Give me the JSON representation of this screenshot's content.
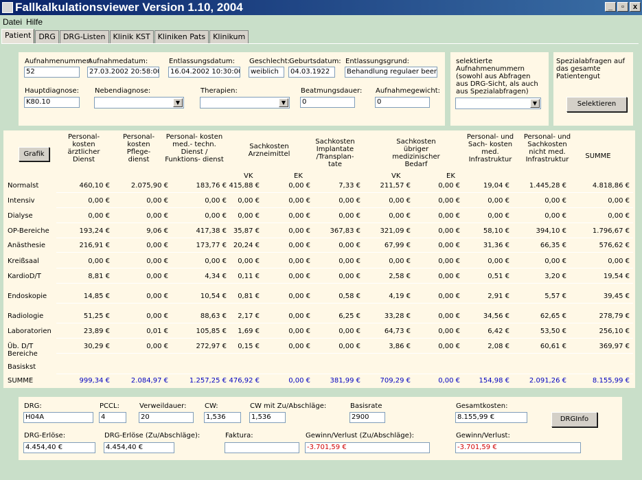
{
  "window": {
    "title": "Fallkalkulationsviewer Version 1.10, 2004",
    "minimize": "_",
    "maximize": "▫",
    "close": "x"
  },
  "menu": [
    "Datei",
    "Hilfe"
  ],
  "tabs": [
    "Patient",
    "DRG",
    "DRG-Listen",
    "Klinik KST",
    "Kliniken Pats",
    "Klinikum"
  ],
  "patient": {
    "aufnahmenummer_label": "Aufnahmenummer:",
    "aufnahmenummer": "52",
    "aufnahmedatum_label": "Aufnahmedatum:",
    "aufnahmedatum": "27.03.2002 20:58:00",
    "entlassungsdatum_label": "Entlassungsdatum:",
    "entlassungsdatum": "16.04.2002 10:30:00",
    "geschlecht_label": "Geschlecht:",
    "geschlecht": "weiblich",
    "geburtsdatum_label": "Geburtsdatum:",
    "geburtsdatum": "04.03.1922",
    "entlassungsgrund_label": "Entlassungsgrund:",
    "entlassungsgrund": "Behandlung regulaer beendet",
    "hauptdiagnose_label": "Hauptdiagnose:",
    "hauptdiagnose": "K80.10",
    "nebendiagnose_label": "Nebendiagnose:",
    "nebendiagnose": "",
    "therapien_label": "Therapien:",
    "therapien": "",
    "beatmungsdauer_label": "Beatmungsdauer:",
    "beatmungsdauer": "0",
    "aufnahmegewicht_label": "Aufnahmegewicht:",
    "aufnahmegewicht": "0"
  },
  "selection": {
    "text": "selektierte Aufnahmenummern (sowohl aus Abfragen aus DRG-Sicht, als auch aus Spezialabfragen)",
    "value": ""
  },
  "special": {
    "text": "Spezialabfragen auf das gesamte Patientengut",
    "button": "Selektieren"
  },
  "costs": {
    "grafik_button": "Grafik",
    "headers": [
      "Personal-\nkosten\närztlicher\nDienst",
      "Personal-\nkosten\nPflege-\ndienst",
      "Personal- kosten\nmed.- techn.\nDienst /\nFunktions- dienst",
      "Sachkosten\nArzneimittel",
      "Sachkosten\nImplantate\n/Transplan-\ntate",
      "Sachkosten\nübriger\nmedizinischer\nBedarf",
      "Personal- und\nSach- kosten\nmed.\nInfrastruktur",
      "Personal- und\nSachkosten\nnicht med.\nInfrastruktur",
      "SUMME"
    ],
    "sub_vk": "VK",
    "sub_ek": "EK",
    "rows": [
      {
        "label": "Normalst",
        "values": [
          "460,10 €",
          "2.075,90 €",
          "183,76 €",
          "415,88 €",
          "0,00 €",
          "7,33 €",
          "211,57 €",
          "0,00 €",
          "19,04 €",
          "1.445,28 €",
          "4.818,86 €"
        ]
      },
      {
        "label": "Intensiv",
        "values": [
          "0,00 €",
          "0,00 €",
          "0,00 €",
          "0,00 €",
          "0,00 €",
          "0,00 €",
          "0,00 €",
          "0,00 €",
          "0,00 €",
          "0,00 €",
          "0,00 €"
        ]
      },
      {
        "label": "Dialyse",
        "values": [
          "0,00 €",
          "0,00 €",
          "0,00 €",
          "0,00 €",
          "0,00 €",
          "0,00 €",
          "0,00 €",
          "0,00 €",
          "0,00 €",
          "0,00 €",
          "0,00 €"
        ]
      },
      {
        "label": "OP-Bereiche",
        "values": [
          "193,24 €",
          "9,06 €",
          "417,38 €",
          "35,87 €",
          "0,00 €",
          "367,83 €",
          "321,09 €",
          "0,00 €",
          "58,10 €",
          "394,10 €",
          "1.796,67 €"
        ]
      },
      {
        "label": "Anästhesie",
        "values": [
          "216,91 €",
          "0,00 €",
          "173,77 €",
          "20,24 €",
          "0,00 €",
          "0,00 €",
          "67,99 €",
          "0,00 €",
          "31,36 €",
          "66,35 €",
          "576,62 €"
        ]
      },
      {
        "label": "Kreißsaal",
        "values": [
          "0,00 €",
          "0,00 €",
          "0,00 €",
          "0,00 €",
          "0,00 €",
          "0,00 €",
          "0,00 €",
          "0,00 €",
          "0,00 €",
          "0,00 €",
          "0,00 €"
        ]
      },
      {
        "label": "KardioD/T",
        "values": [
          "8,81 €",
          "0,00 €",
          "4,34 €",
          "0,11 €",
          "0,00 €",
          "0,00 €",
          "2,58 €",
          "0,00 €",
          "0,51 €",
          "3,20 €",
          "19,54 €"
        ]
      },
      {
        "label": "Endoskopie",
        "values": [
          "14,85 €",
          "0,00 €",
          "10,54 €",
          "0,81 €",
          "0,00 €",
          "0,58 €",
          "4,19 €",
          "0,00 €",
          "2,91 €",
          "5,57 €",
          "39,45 €"
        ]
      },
      {
        "label": "Radiologie",
        "values": [
          "51,25 €",
          "0,00 €",
          "88,63 €",
          "2,17 €",
          "0,00 €",
          "6,25 €",
          "33,28 €",
          "0,00 €",
          "34,56 €",
          "62,65 €",
          "278,79 €"
        ]
      },
      {
        "label": "Laboratorien",
        "values": [
          "23,89 €",
          "0,01 €",
          "105,85 €",
          "1,69 €",
          "0,00 €",
          "0,00 €",
          "64,73 €",
          "0,00 €",
          "6,42 €",
          "53,50 €",
          "256,10 €"
        ]
      },
      {
        "label": "Üb. D/T\nBereiche",
        "values": [
          "30,29 €",
          "0,00 €",
          "272,97 €",
          "0,15 €",
          "0,00 €",
          "0,00 €",
          "3,86 €",
          "0,00 €",
          "2,08 €",
          "60,61 €",
          "369,97 €"
        ]
      },
      {
        "label": "Basiskst",
        "values": [
          "",
          "",
          "",
          "",
          "",
          "",
          "",
          "",
          "",
          "",
          ""
        ]
      },
      {
        "label": "SUMME",
        "values": [
          "999,34 €",
          "2.084,97 €",
          "1.257,25 €",
          "476,92 €",
          "0,00 €",
          "381,99 €",
          "709,29 €",
          "0,00 €",
          "154,98 €",
          "2.091,26 €",
          "8.155,99 €"
        ]
      }
    ]
  },
  "drg": {
    "drg_label": "DRG:",
    "drg": "H04A",
    "pccl_label": "PCCL:",
    "pccl": "4",
    "verweildauer_label": "Verweildauer:",
    "verweildauer": "20",
    "cw_label": "CW:",
    "cw": "1,536",
    "cw_zu_label": "CW mit Zu/Abschläge:",
    "cw_zu": "1,536",
    "basisrate_label": "Basisrate",
    "basisrate": "2900",
    "gesamtkosten_label": "Gesamtkosten:",
    "gesamtkosten": "8.155,99 €",
    "drginfo_button": "DRGInfo",
    "erloese_label": "DRG-Erlöse:",
    "erloese": "4.454,40 €",
    "erloese_zu_label": "DRG-Erlöse (Zu/Abschläge):",
    "erloese_zu": "4.454,40 €",
    "faktura_label": "Faktura:",
    "faktura": "",
    "gewinn_zu_label": "Gewinn/Verlust (Zu/Abschläge):",
    "gewinn_zu": "-3.701,59 €",
    "gewinn_label": "Gewinn/Verlust:",
    "gewinn": "-3.701,59 €"
  },
  "colors": {
    "background": "#c9dfc9",
    "panel": "#fff8e6",
    "total_blue": "#0000c0",
    "loss_red": "#d00000",
    "title_start": "#0a246a",
    "title_end": "#3a6ea5"
  }
}
